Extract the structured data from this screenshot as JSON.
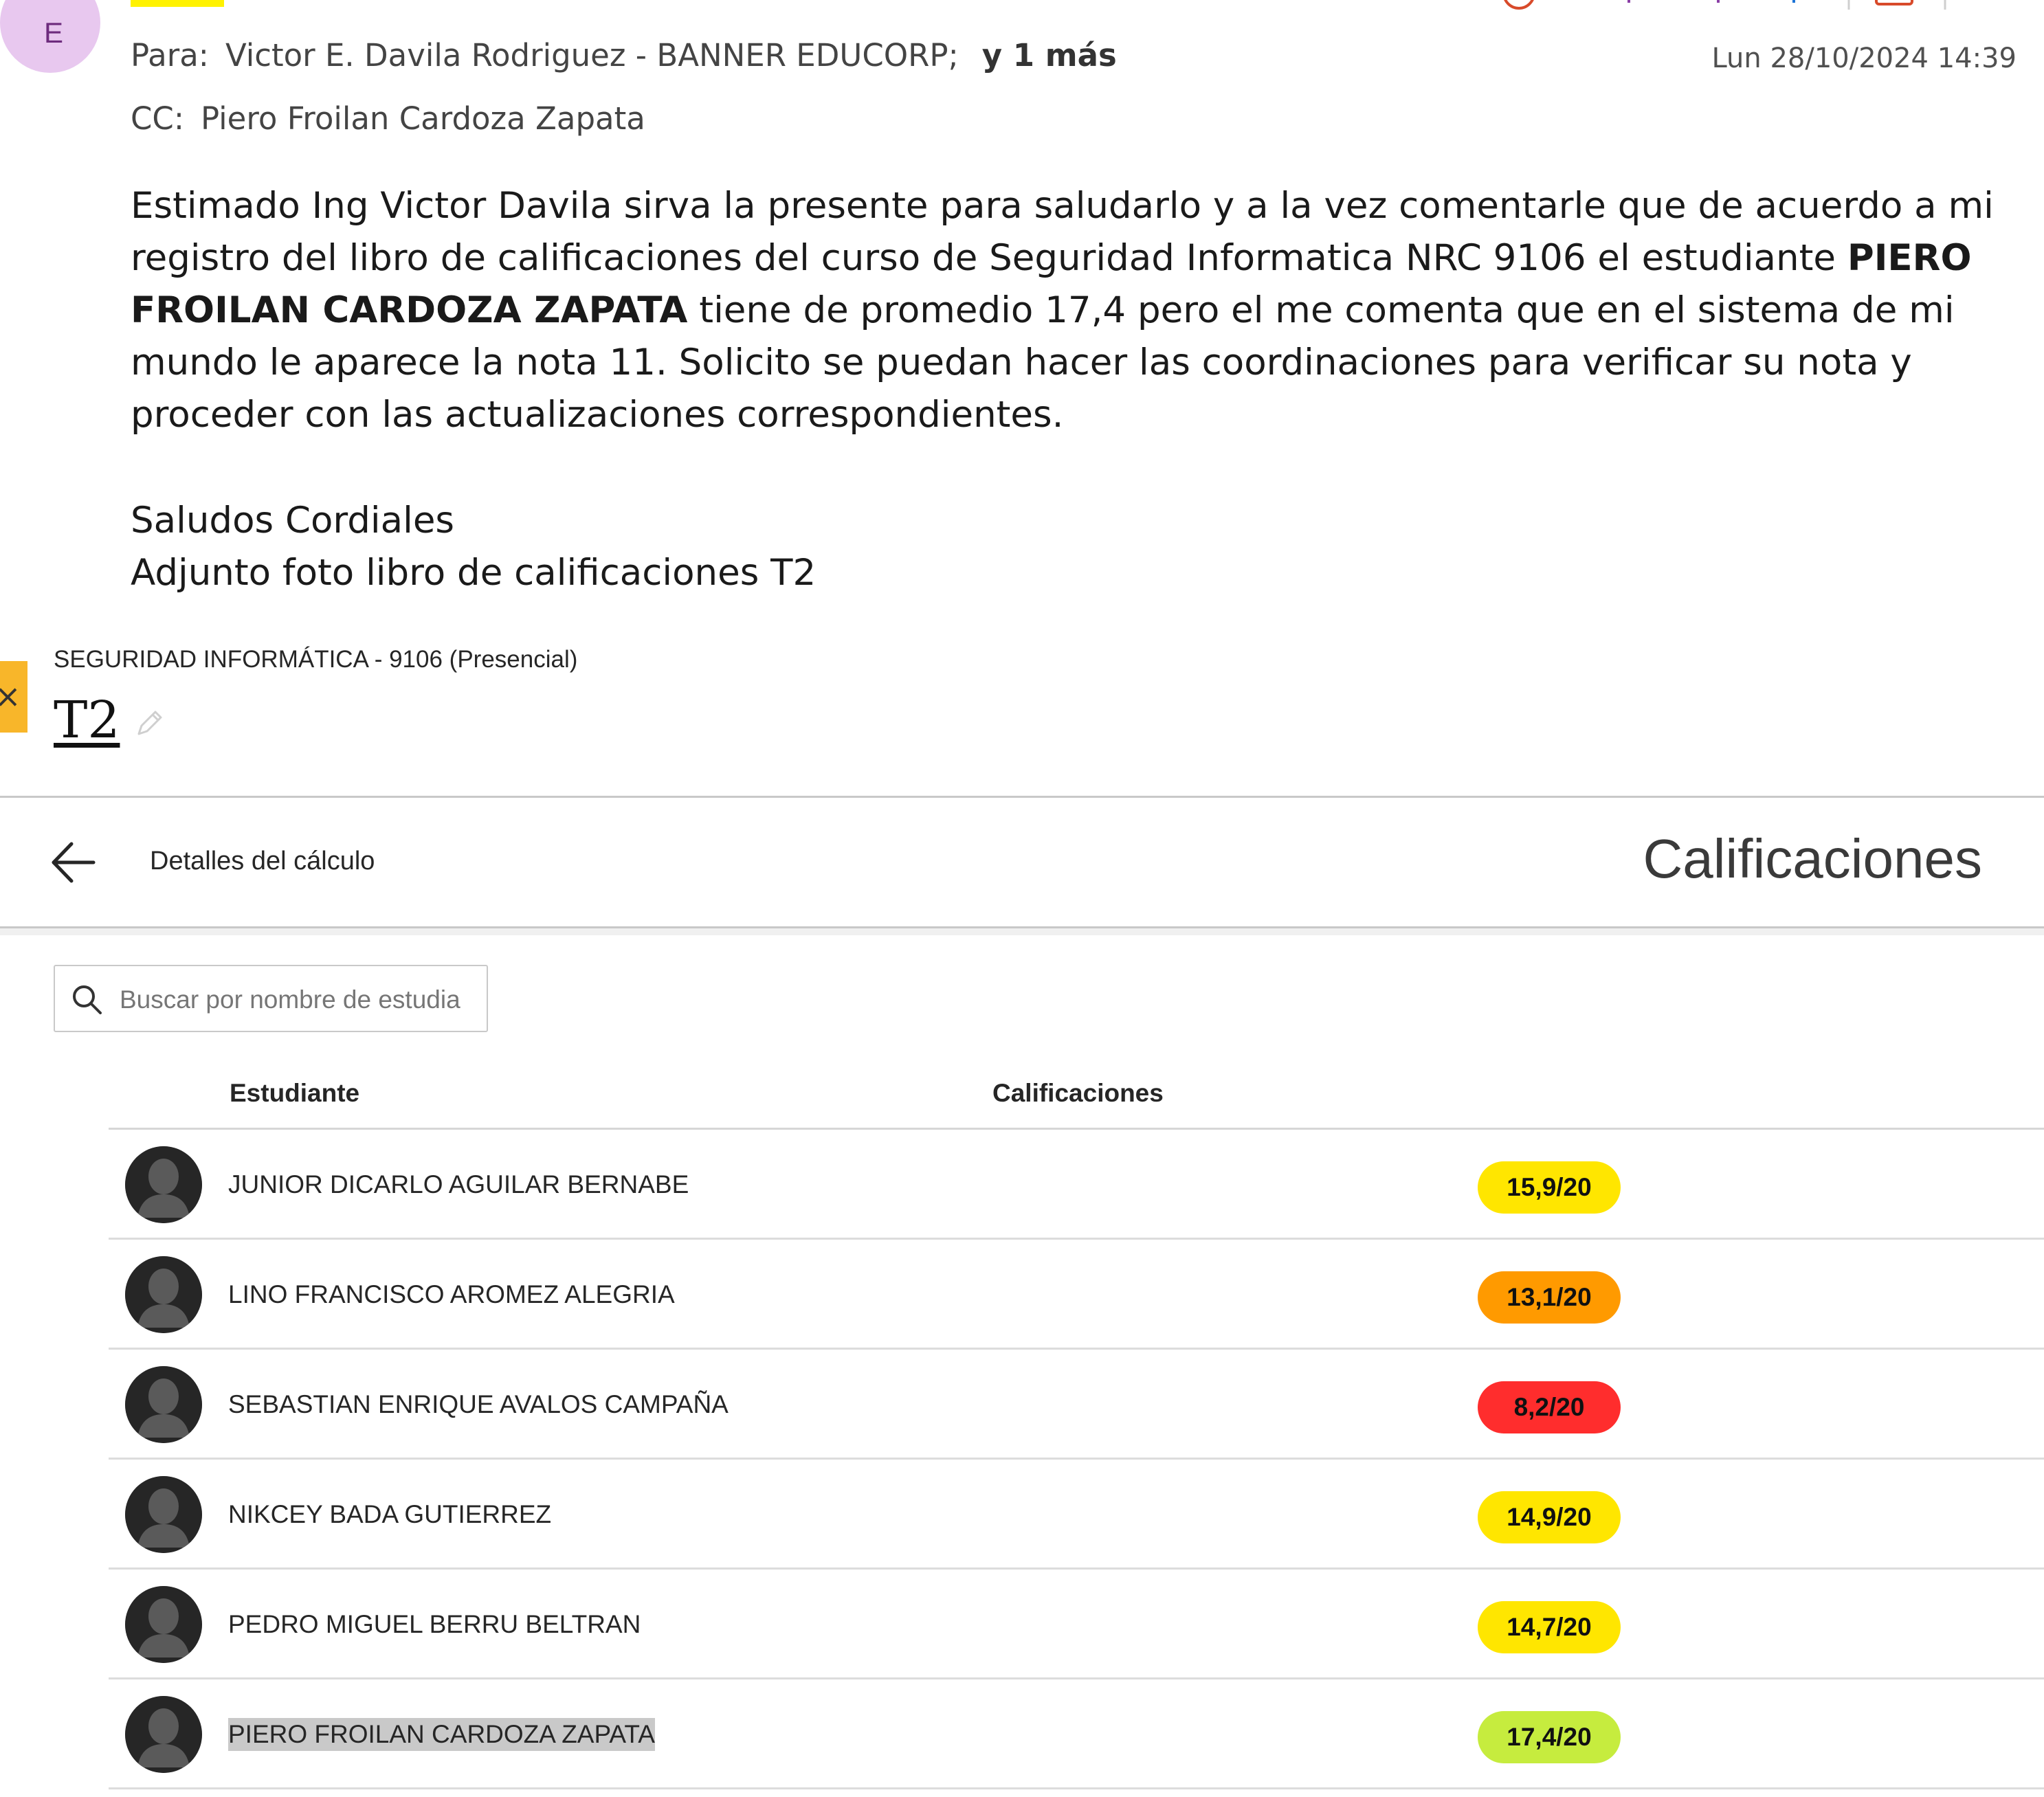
{
  "email": {
    "sender_initial": "E",
    "to_label": "Para:",
    "to_value": "Victor E. Davila Rodriguez - BANNER EDUCORP;",
    "to_more": "y 1 más",
    "cc_label": "CC:",
    "cc_value": "Piero Froilan Cardoza Zapata",
    "date": "Lun 28/10/2024 14:39",
    "body_part1": "Estimado Ing Victor Davila sirva la presente para saludarlo y a la vez comentarle que de acuerdo a mi registro del libro de calificaciones del curso de Seguridad Informatica NRC 9106 el estudiante ",
    "body_bold": "PIERO FROILAN CARDOZA ZAPATA",
    "body_part2": " tiene de promedio 17,4 pero el me comenta que en el sistema de mi mundo le aparece la nota 11. Solicito se puedan hacer las coordinaciones para verificar su nota y proceder con las actualizaciones correspondientes.",
    "closing": "Saludos Cordiales",
    "attachment_note": "Adjunto foto libro de calificaciones T2"
  },
  "gradebook": {
    "course_title": "SEGURIDAD INFORMÁTICA - 9106 (Presencial)",
    "item_title": "T2",
    "back_label": "Detalles del cálculo",
    "panel_title": "Calificaciones",
    "search_placeholder": "Buscar por nombre de estudia",
    "col_student": "Estudiante",
    "col_grades": "Calificaciones",
    "rows": [
      {
        "name": "JUNIOR DICARLO AGUILAR BERNABE",
        "grade": "15,9/20",
        "color": "#ffe600"
      },
      {
        "name": "LINO FRANCISCO AROMEZ ALEGRIA",
        "grade": "13,1/20",
        "color": "#ff9a00"
      },
      {
        "name": "SEBASTIAN ENRIQUE AVALOS CAMPAÑA",
        "grade": "8,2/20",
        "color": "#ff2d2d"
      },
      {
        "name": "NIKCEY BADA GUTIERREZ",
        "grade": "14,9/20",
        "color": "#ffe600"
      },
      {
        "name": "PEDRO MIGUEL BERRU BELTRAN",
        "grade": "14,7/20",
        "color": "#ffe600"
      },
      {
        "name": "PIERO FROILAN CARDOZA ZAPATA",
        "grade": "17,4/20",
        "color": "#c6ec3e"
      }
    ]
  },
  "icons": {
    "edit": "pencil-icon",
    "back": "arrow-left-icon",
    "search": "search-icon",
    "avatar": "user-silhouette-icon"
  }
}
